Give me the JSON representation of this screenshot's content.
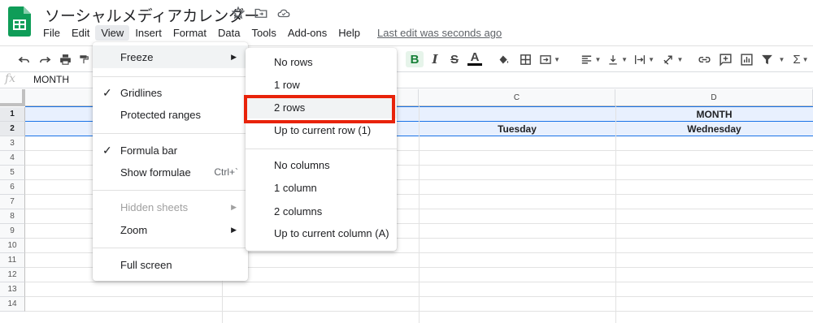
{
  "doc": {
    "title": "ソーシャルメディアカレンダー"
  },
  "menubar": {
    "items": [
      "File",
      "Edit",
      "View",
      "Insert",
      "Format",
      "Data",
      "Tools",
      "Add-ons",
      "Help"
    ],
    "active": "View",
    "last_edit": "Last edit was seconds ago"
  },
  "toolbar": {
    "bold_label": "B",
    "italic_label": "I",
    "strike_label": "S",
    "text_color_label": "A",
    "sum_label": "Σ"
  },
  "formula_bar": {
    "fx_label": "fx",
    "value": "MONTH"
  },
  "grid": {
    "columns": [
      "C",
      "D"
    ],
    "rows": [
      "1",
      "2",
      "3",
      "4",
      "5",
      "6",
      "7",
      "8",
      "9",
      "10",
      "11",
      "12",
      "13",
      "14"
    ],
    "cells": {
      "d1": "MONTH",
      "c2": "Tuesday",
      "d2": "Wednesday"
    }
  },
  "view_menu": {
    "items": [
      {
        "label": "Freeze",
        "submenu": true
      },
      {
        "label": "Gridlines",
        "checked": true
      },
      {
        "label": "Protected ranges"
      },
      {
        "label": "Formula bar",
        "checked": true
      },
      {
        "label": "Show formulae",
        "shortcut": "Ctrl+`"
      },
      {
        "label": "Hidden sheets",
        "submenu": true,
        "disabled": true
      },
      {
        "label": "Zoom",
        "submenu": true
      },
      {
        "label": "Full screen"
      }
    ]
  },
  "freeze_menu": {
    "items": [
      "No rows",
      "1 row",
      "2 rows",
      "Up to current row (1)",
      "No columns",
      "1 column",
      "2 columns",
      "Up to current column (A)"
    ],
    "highlighted": "2 rows"
  },
  "colors": {
    "accent": "#1a73e8",
    "highlight_box": "#e8230a",
    "logo_green": "#0f9d58"
  }
}
